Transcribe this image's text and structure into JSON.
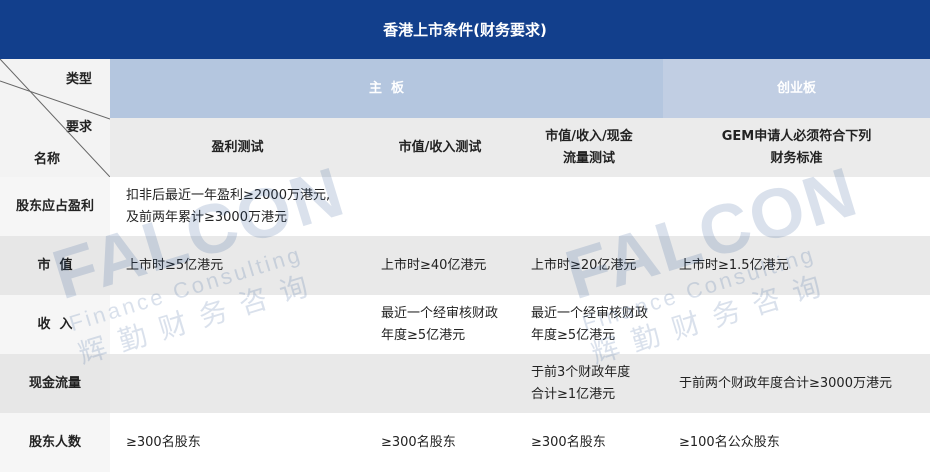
{
  "title": "香港上市条件(财务要求)",
  "header": {
    "corner": {
      "type_label": "类型",
      "req_label": "要求",
      "name_label": "名称"
    },
    "main_board": "主  板",
    "gem_board": "创业板",
    "tests": [
      "盈利测试",
      "市值/收入测试",
      "市值/收入/现金\n流量测试",
      "GEM申请人必须符合下列\n财务标准"
    ]
  },
  "rows": [
    {
      "label": "股东应占盈利",
      "cells": [
        "扣非后最近一年盈利≥2000万港元,\n及前两年累计≥3000万港元",
        "",
        "",
        ""
      ]
    },
    {
      "label": "市  值",
      "cells": [
        "上市时≥5亿港元",
        "上市时≥40亿港元",
        "上市时≥20亿港元",
        "上市时≥1.5亿港元"
      ]
    },
    {
      "label": "收  入",
      "cells": [
        "",
        "最近一个经审核财政\n年度≥5亿港元",
        "最近一个经审核财政\n年度≥5亿港元",
        ""
      ]
    },
    {
      "label": "现金流量",
      "cells": [
        "",
        "",
        "于前3个财政年度\n合计≥1亿港元",
        "于前两个财政年度合计≥3000万港元"
      ]
    },
    {
      "label": "股东人数",
      "cells": [
        "≥300名股东",
        "≥300名股东",
        "≥300名股东",
        "≥100名公众股东"
      ]
    }
  ],
  "watermark": {
    "brand": "FALCON",
    "english": "Finance Consulting",
    "chinese": "辉勤财务咨询"
  }
}
